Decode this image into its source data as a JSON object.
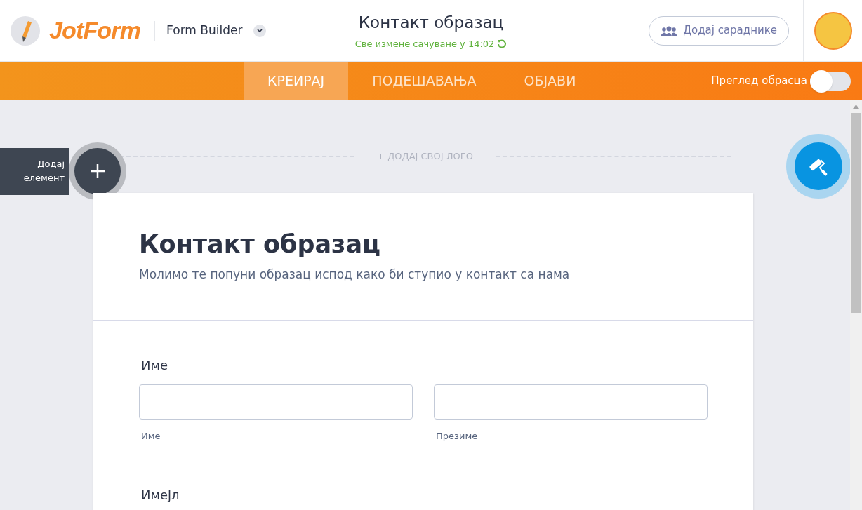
{
  "header": {
    "brand": "JotForm",
    "product": "Form Builder",
    "form_title": "Контакт образац",
    "save_status": "Све измене сачуване у 14:02",
    "collaborators_button": "Додај сараднике"
  },
  "tabs": [
    {
      "label": "КРЕИРАЈ",
      "selected": true
    },
    {
      "label": "ПОДЕШАВАЊА",
      "selected": false
    },
    {
      "label": "ОБЈАВИ",
      "selected": false
    }
  ],
  "preview_toggle": {
    "label": "Преглед обрасца",
    "on": false
  },
  "add_element": {
    "label": "Додај елемент"
  },
  "add_logo": "+ ДОДАЈ СВОЈ ЛОГО",
  "form": {
    "title": "Контакт образац",
    "subtitle": "Молимо те попуни образац испод како би ступио у контакт са нама",
    "fields": [
      {
        "kind": "name",
        "label": "Име",
        "sublabels": [
          "Име",
          "Презиме"
        ]
      },
      {
        "kind": "email",
        "label": "Имејл"
      }
    ]
  }
}
